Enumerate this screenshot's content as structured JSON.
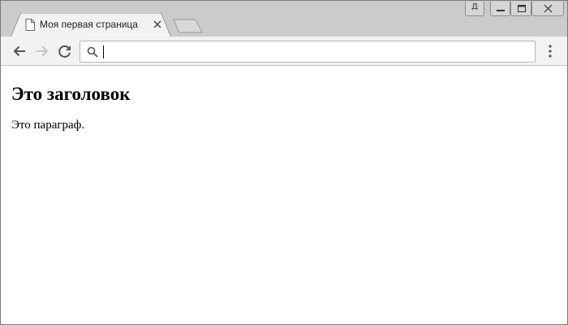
{
  "browser": {
    "tab": {
      "title": "Моя первая страница"
    },
    "profile_label": "Д",
    "omnibox": {
      "value": "",
      "placeholder": ""
    }
  },
  "page": {
    "heading": "Это заголовок",
    "paragraph": "Это параграф."
  },
  "icons": {
    "page": "document-icon",
    "close_tab": "close-icon",
    "new_tab": "new-tab-icon",
    "back": "arrow-left-icon",
    "forward": "arrow-right-icon",
    "reload": "reload-icon",
    "search": "search-icon",
    "menu": "kebab-menu-icon",
    "minimize": "minimize-icon",
    "maximize": "maximize-icon",
    "close_window": "close-icon"
  },
  "colors": {
    "titlebar": "#cbcbcb",
    "toolbar": "#f2f2f2",
    "page_background": "#ffffff",
    "text": "#000000"
  }
}
